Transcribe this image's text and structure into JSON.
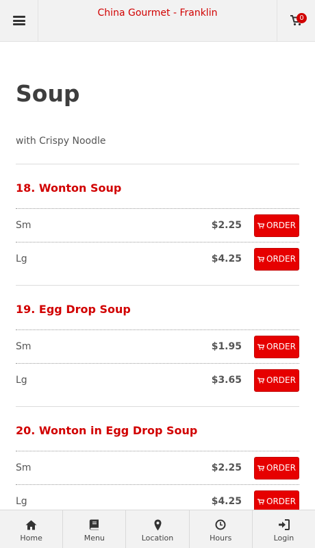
{
  "header": {
    "title": "China Gourmet - Franklin",
    "cart_count": "0",
    "menu_icon": "hamburger-icon",
    "cart_icon": "shopping-cart-icon"
  },
  "category": {
    "title": "Soup",
    "description": "with Crispy Noodle"
  },
  "items": [
    {
      "name": "18. Wonton Soup",
      "variants": [
        {
          "label": "Sm",
          "price": "$2.25",
          "button": "ORDER"
        },
        {
          "label": "Lg",
          "price": "$4.25",
          "button": "ORDER"
        }
      ]
    },
    {
      "name": "19. Egg Drop Soup",
      "variants": [
        {
          "label": "Sm",
          "price": "$1.95",
          "button": "ORDER"
        },
        {
          "label": "Lg",
          "price": "$3.65",
          "button": "ORDER"
        }
      ]
    },
    {
      "name": "20. Wonton in Egg Drop Soup",
      "variants": [
        {
          "label": "Sm",
          "price": "$2.25",
          "button": "ORDER"
        },
        {
          "label": "Lg",
          "price": "$4.25",
          "button": "ORDER"
        }
      ]
    }
  ],
  "bottom_nav": [
    {
      "label": "Home",
      "icon": "home-icon"
    },
    {
      "label": "Menu",
      "icon": "book-icon"
    },
    {
      "label": "Location",
      "icon": "map-pin-icon"
    },
    {
      "label": "Hours",
      "icon": "clock-icon"
    },
    {
      "label": "Login",
      "icon": "login-icon"
    }
  ],
  "colors": {
    "accent": "#d10000",
    "button": "#e60000",
    "header_bg": "#f2f2f2"
  }
}
